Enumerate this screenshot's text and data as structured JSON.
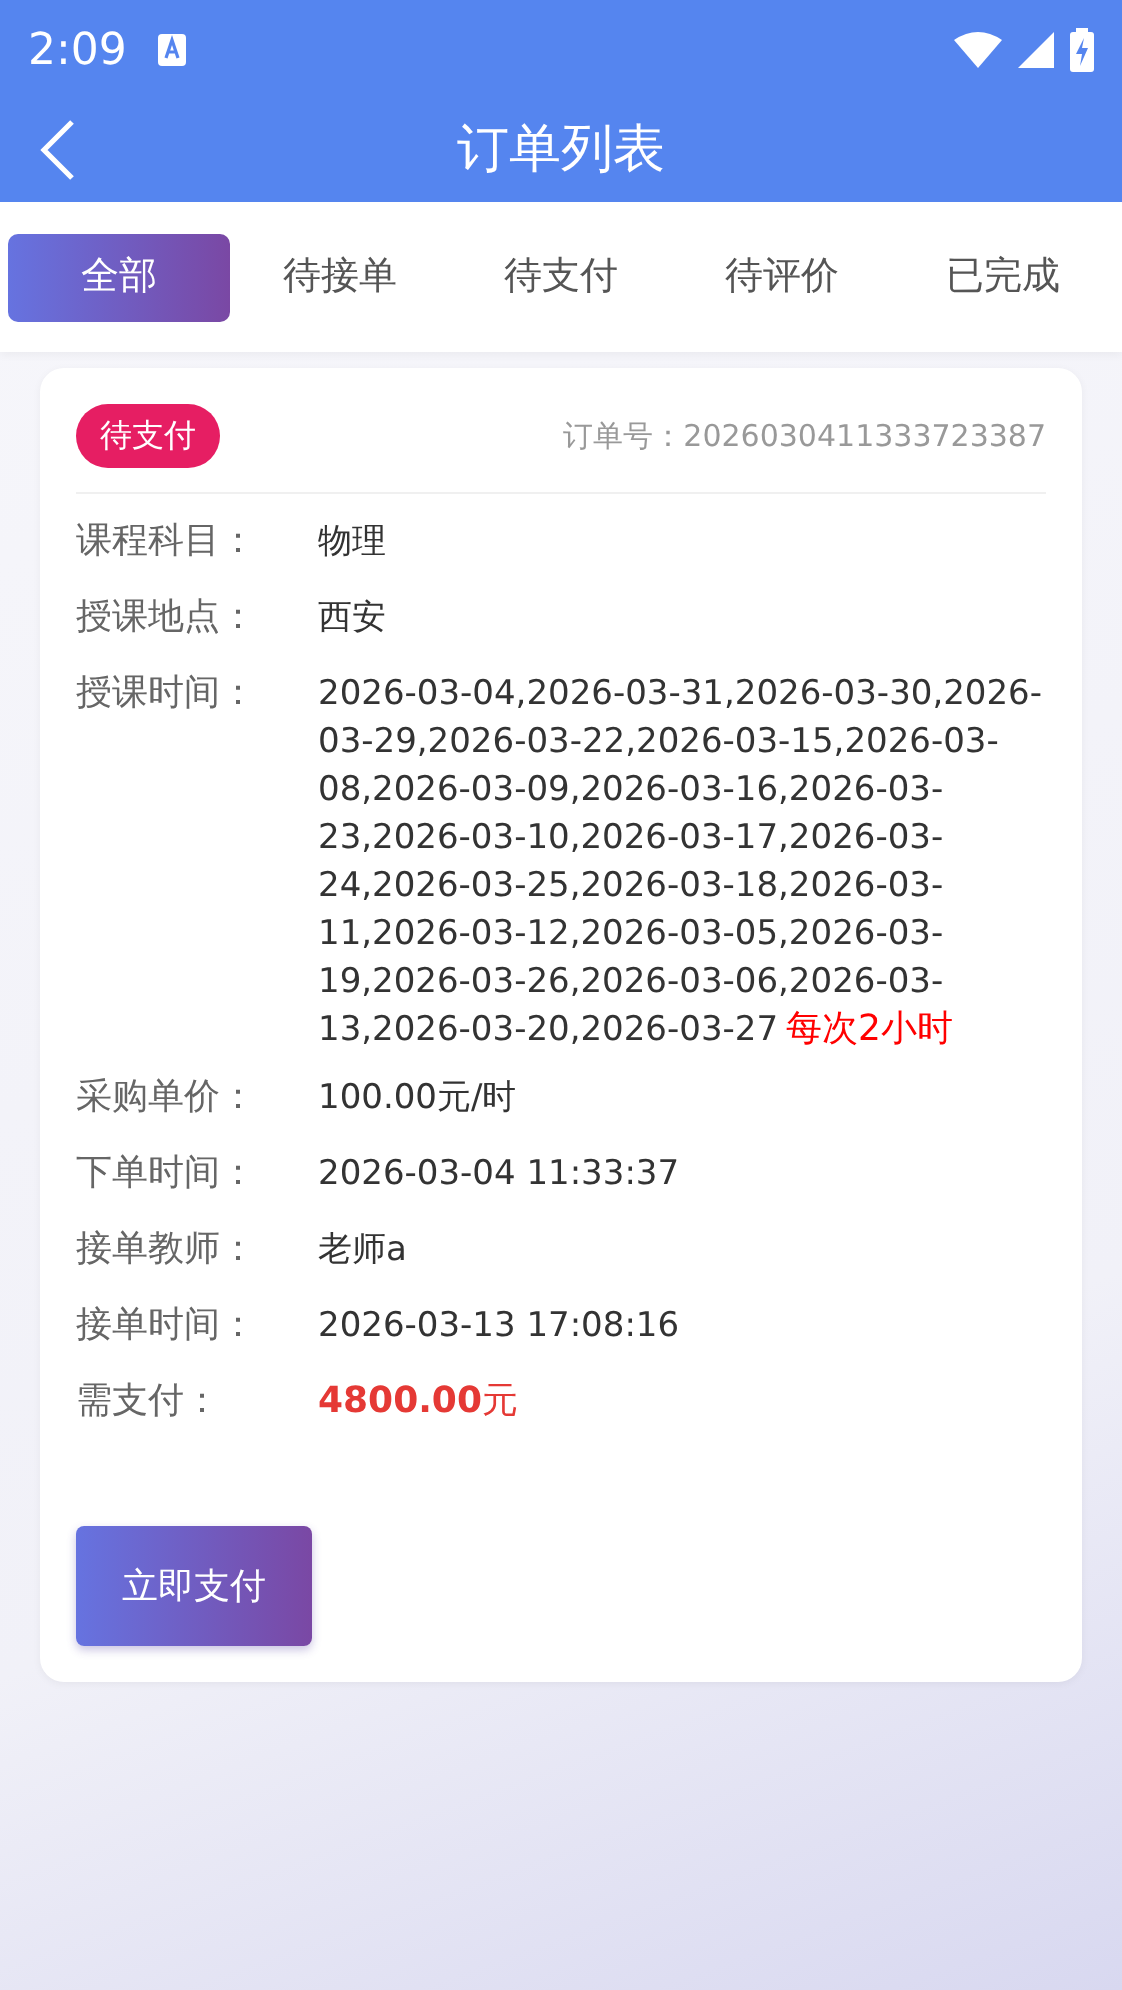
{
  "status_bar": {
    "time": "2:09"
  },
  "header": {
    "title": "订单列表"
  },
  "tabs": [
    {
      "label": "全部",
      "selected": true
    },
    {
      "label": "待接单",
      "selected": false
    },
    {
      "label": "待支付",
      "selected": false
    },
    {
      "label": "待评价",
      "selected": false
    },
    {
      "label": "已完成",
      "selected": false
    }
  ],
  "order": {
    "status": "待支付",
    "order_no": "订单号：2026030411333723387",
    "fields": [
      {
        "kind": "plain",
        "label": "课程科目：",
        "value": "物理"
      },
      {
        "kind": "plain",
        "label": "授课地点：",
        "value": "西安"
      },
      {
        "kind": "plain",
        "label": "授课时间：",
        "value": "2026-03-04,2026-03-31,2026-03-30,2026-03-29,2026-03-22,2026-03-15,2026-03-08,2026-03-09,2026-03-16,2026-03-23,2026-03-10,2026-03-17,2026-03-24,2026-03-25,2026-03-18,2026-03-11,2026-03-12,2026-03-05,2026-03-19,2026-03-26,2026-03-06,2026-03-13,2026-03-20,2026-03-27",
        "note": "每次2小时"
      },
      {
        "kind": "plain",
        "label": "采购单价：",
        "value": "100.00元/时"
      },
      {
        "kind": "plain",
        "label": "下单时间：",
        "value": "2026-03-04 11:33:37"
      },
      {
        "kind": "plain",
        "label": "接单教师：",
        "value": "老师a"
      },
      {
        "kind": "plain",
        "label": "接单时间：",
        "value": "2026-03-13 17:08:16"
      },
      {
        "kind": "amount",
        "label": "需支付：",
        "value": "**4800.00**元"
      }
    ],
    "button": "立即支付"
  }
}
